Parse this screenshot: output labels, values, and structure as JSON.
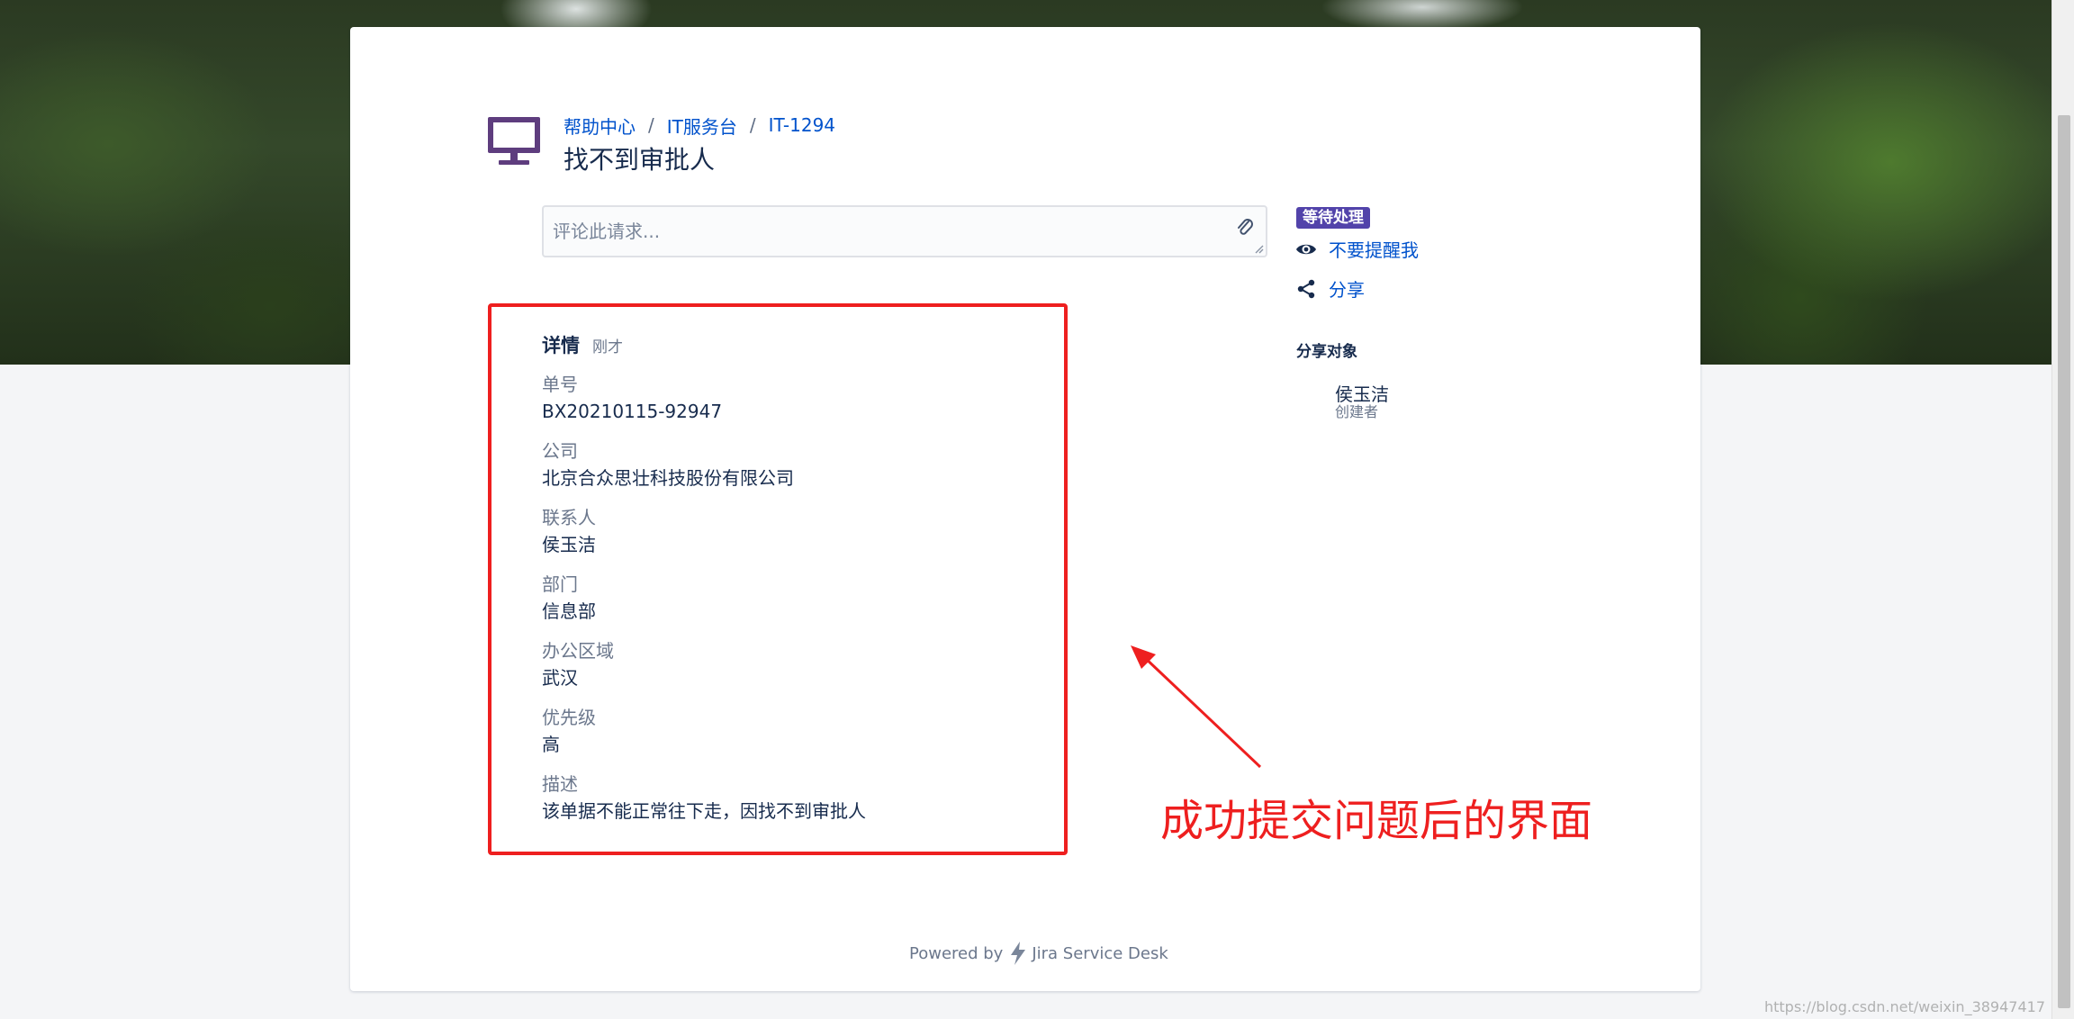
{
  "breadcrumb": {
    "help_center": "帮助中心",
    "service_desk": "IT服务台",
    "issue_key": "IT-1294",
    "separator": "/"
  },
  "request": {
    "title": "找不到审批人"
  },
  "comment": {
    "placeholder": "评论此请求..."
  },
  "sidebar": {
    "status": "等待处理",
    "unwatch_label": "不要提醒我",
    "share_label": "分享",
    "share_heading": "分享对象",
    "sharer_name": "侯玉洁",
    "sharer_role": "创建者"
  },
  "details": {
    "title": "详情",
    "time": "刚才",
    "fields": [
      {
        "label": "单号",
        "value": "BX20210115-92947"
      },
      {
        "label": "公司",
        "value": "北京合众思壮科技股份有限公司"
      },
      {
        "label": "联系人",
        "value": "侯玉洁"
      },
      {
        "label": "部门",
        "value": "信息部"
      },
      {
        "label": "办公区域",
        "value": "武汉"
      },
      {
        "label": "优先级",
        "value": "高"
      },
      {
        "label": "描述",
        "value": "该单据不能正常往下走，因找不到审批人"
      }
    ]
  },
  "annotation": {
    "text": "成功提交问题后的界面"
  },
  "footer": {
    "powered_by": "Powered by",
    "product": "Jira Service Desk"
  },
  "watermark": "https://blog.csdn.net/weixin_38947417",
  "colors": {
    "link": "#0052cc",
    "status_badge": "#5243aa",
    "annotation_red": "#ee1f1f",
    "text_primary": "#172b4d",
    "text_secondary": "#6b778c"
  },
  "icons": {
    "request_type": "monitor-icon",
    "attach": "paperclip-icon",
    "unwatch": "eye-icon",
    "share": "share-icon",
    "footer_logo": "bolt-icon"
  }
}
